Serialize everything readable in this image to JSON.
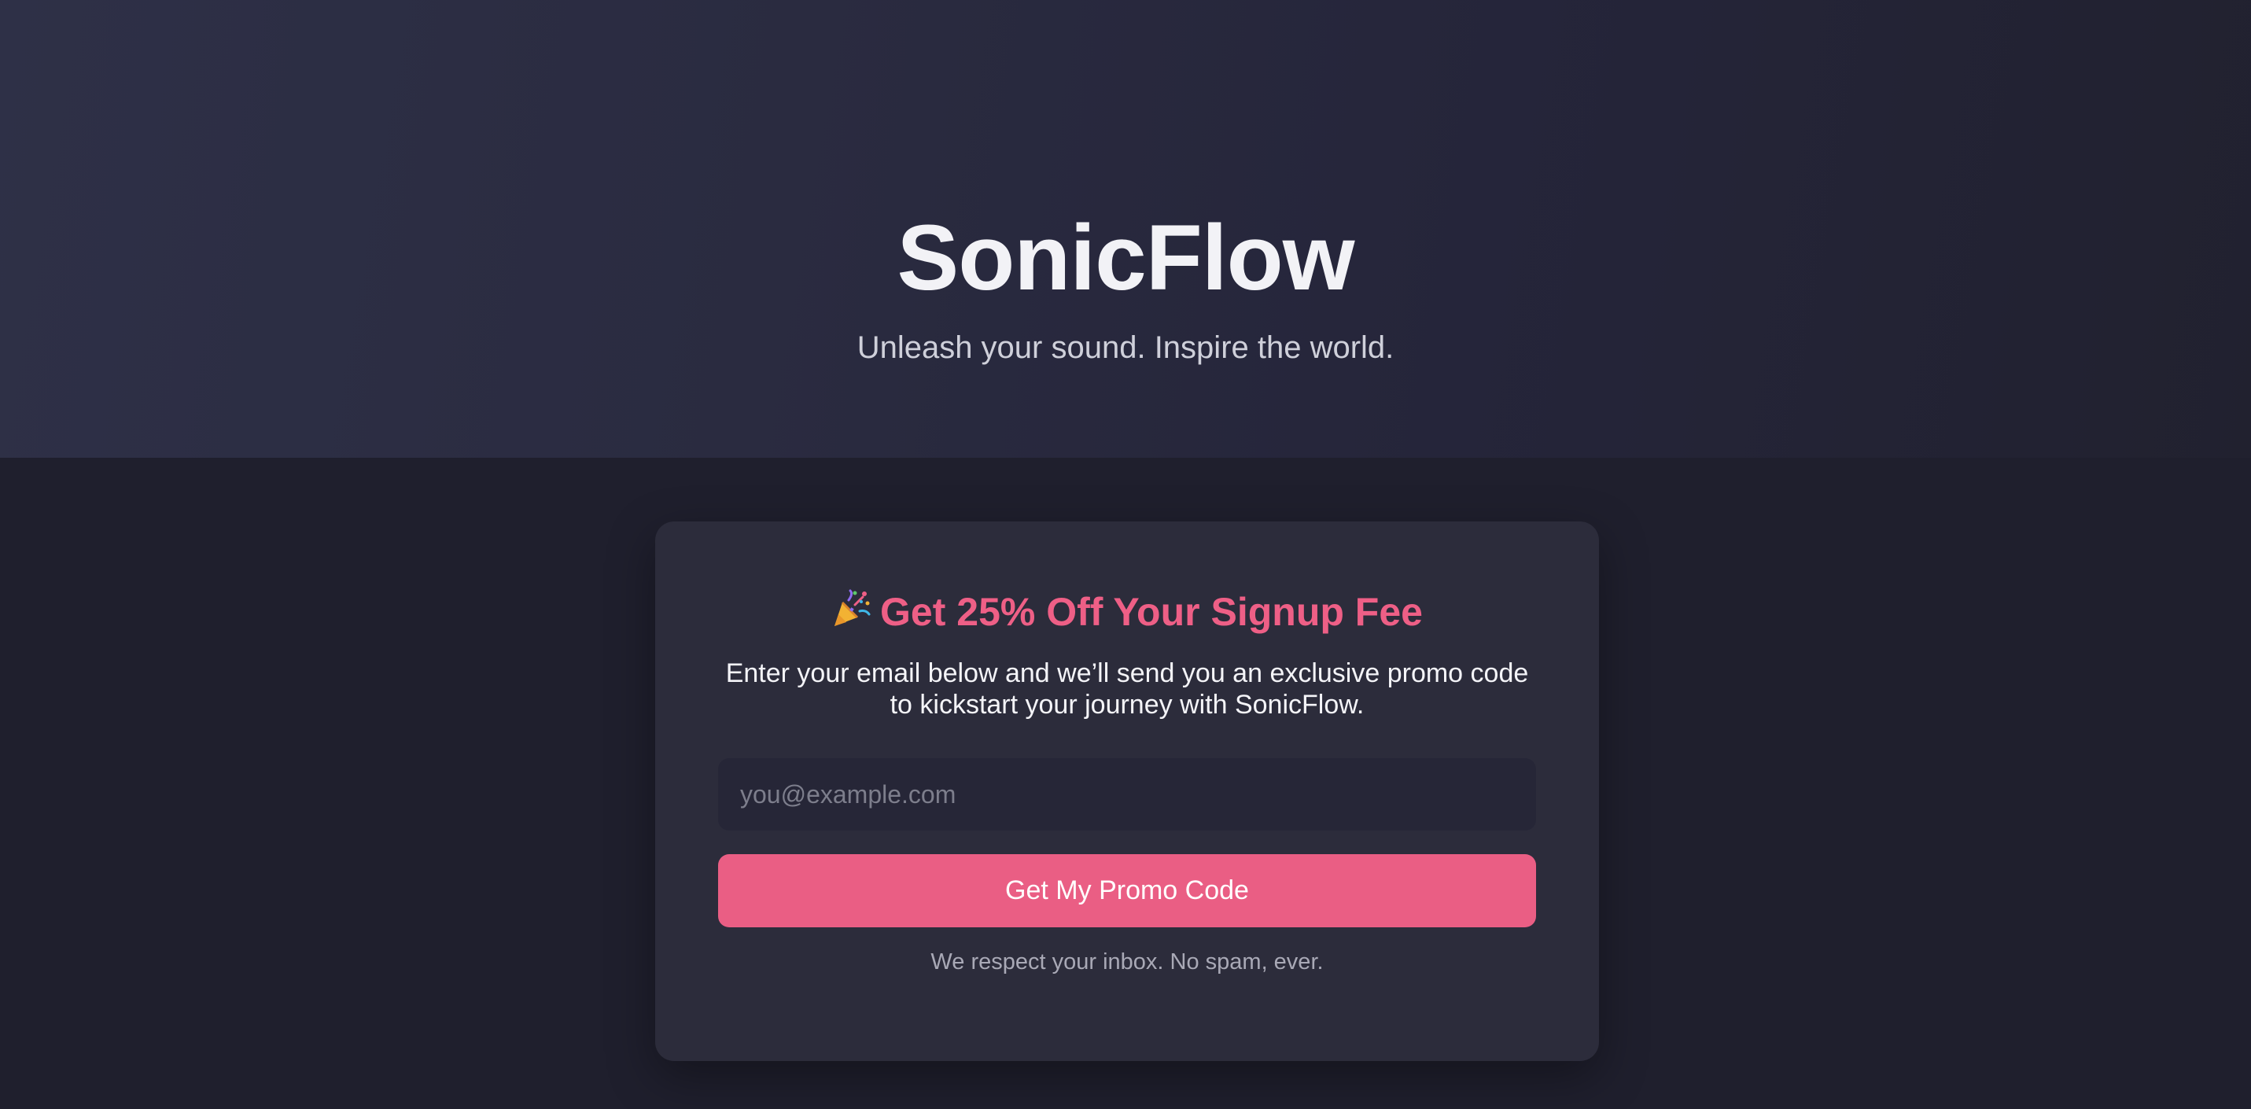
{
  "hero": {
    "title": "SonicFlow",
    "tagline": "Unleash your sound. Inspire the world."
  },
  "signup_card": {
    "icon": "party-popper-icon",
    "heading": "Get 25% Off Your Signup Fee",
    "body": "Enter your email below and we’ll send you an exclusive promo code to kickstart your journey with SonicFlow.",
    "email_placeholder": "you@example.com",
    "email_value": "",
    "button_label": "Get My Promo Code",
    "privacy_note": "We respect your inbox. No spam, ever."
  },
  "colors": {
    "accent": "#ea5e84",
    "page_background": "#1f1f2d",
    "card_background": "#2c2c3b"
  }
}
